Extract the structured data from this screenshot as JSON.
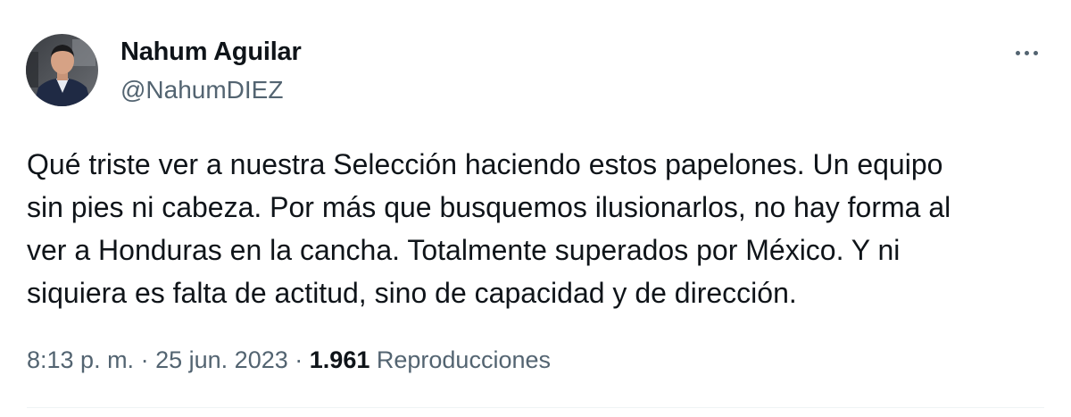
{
  "tweet": {
    "author": {
      "display_name": "Nahum Aguilar",
      "handle": "@NahumDIEZ"
    },
    "text_lines": [
      "Qué triste ver a nuestra Selección haciendo estos papelones. Un equipo",
      "sin pies ni cabeza. Por más que busquemos ilusionarlos, no hay forma al",
      "ver a Honduras en la cancha. Totalmente superados por México. Y ni",
      "siquiera es falta de actitud, sino de capacidad y de dirección."
    ],
    "time": "8:13 p. m.",
    "separator": "·",
    "date": "25 jun. 2023",
    "views_count": "1.961",
    "views_label": "Reproducciones",
    "more_icon": "more-horizontal-icon"
  },
  "colors": {
    "text_primary": "#0f1419",
    "text_secondary": "#536471",
    "divider": "#eff3f4"
  }
}
